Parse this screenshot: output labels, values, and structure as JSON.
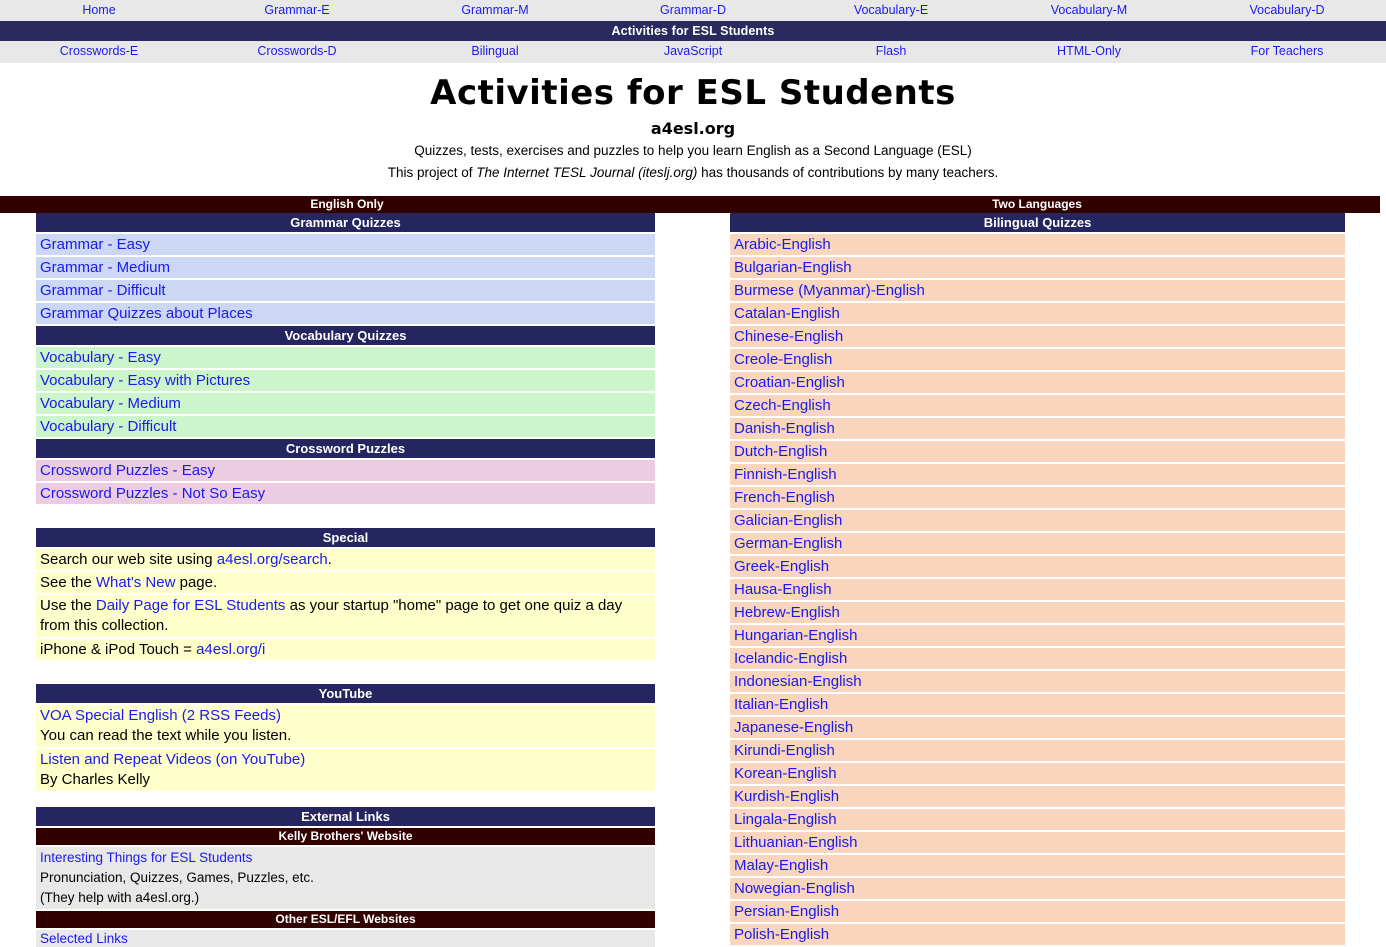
{
  "nav_top": [
    {
      "label": "Home"
    },
    {
      "label": "Grammar-E"
    },
    {
      "label": "Grammar-M"
    },
    {
      "label": "Grammar-D"
    },
    {
      "label": "Vocabulary-E"
    },
    {
      "label": "Vocabulary-M"
    },
    {
      "label": "Vocabulary-D"
    }
  ],
  "site_titlebar": "Activities for ESL Students",
  "nav_bottom": [
    {
      "label": "Crosswords-E"
    },
    {
      "label": "Crosswords-D"
    },
    {
      "label": "Bilingual"
    },
    {
      "label": "JavaScript"
    },
    {
      "label": "Flash"
    },
    {
      "label": "HTML-Only"
    },
    {
      "label": "For Teachers"
    }
  ],
  "masthead": {
    "title": "Activities for ESL Students",
    "sitename": "a4esl.org",
    "tagline1": "Quizzes, tests, exercises and puzzles to help you learn English as a Second Language (ESL)",
    "tagline2_pre": "This project of ",
    "tagline2_em": "The Internet TESL Journal (iteslj.org)",
    "tagline2_post": " has thousands of contributions by many teachers."
  },
  "left": {
    "banner": "English Only",
    "grammar": {
      "header": "Grammar Quizzes",
      "items": [
        "Grammar - Easy",
        "Grammar - Medium",
        "Grammar - Difficult",
        "Grammar Quizzes about Places"
      ]
    },
    "vocabulary": {
      "header": "Vocabulary Quizzes",
      "items": [
        "Vocabulary - Easy",
        "Vocabulary - Easy with Pictures",
        "Vocabulary - Medium",
        "Vocabulary - Difficult"
      ]
    },
    "crossword": {
      "header": "Crossword Puzzles",
      "items": [
        "Crossword Puzzles - Easy",
        "Crossword Puzzles - Not So Easy"
      ]
    },
    "special": {
      "header": "Special",
      "row1_pre": "Search our web site using ",
      "row1_link": "a4esl.org/search",
      "row1_post": ".",
      "row2_pre": "See the ",
      "row2_link": "What's New",
      "row2_post": " page.",
      "row3_pre": "Use the ",
      "row3_link": "Daily Page for ESL Students",
      "row3_post": " as your startup \"home\" page to get one quiz a day from this collection.",
      "row4_pre": "iPhone & iPod Touch = ",
      "row4_link": "a4esl.org/i"
    },
    "youtube": {
      "header": "YouTube",
      "row1_link": "VOA Special English (2 RSS Feeds)",
      "row1_text": "You can read the text while you listen.",
      "row2_link": "Listen and Repeat Videos (on YouTube)",
      "row2_text": "By Charles Kelly"
    },
    "external": {
      "header": "External Links",
      "sub1": "Kelly Brothers' Website",
      "sub1_link": "Interesting Things for ESL Students",
      "sub1_text1": "Pronunciation, Quizzes, Games, Puzzles, etc.",
      "sub1_text2": "(They help with a4esl.org.)",
      "sub2": "Other ESL/EFL Websites",
      "sub2_link": "Selected Links"
    }
  },
  "right": {
    "banner": "Two Languages",
    "bilingual": {
      "header": "Bilingual Quizzes",
      "items": [
        "Arabic-English",
        "Bulgarian-English",
        "Burmese (Myanmar)-English",
        "Catalan-English",
        "Chinese-English",
        "Creole-English",
        "Croatian-English",
        "Czech-English",
        "Danish-English",
        "Dutch-English",
        "Finnish-English",
        "French-English",
        "Galician-English",
        "German-English",
        "Greek-English",
        "Hausa-English",
        "Hebrew-English",
        "Hungarian-English",
        "Icelandic-English",
        "Indonesian-English",
        "Italian-English",
        "Japanese-English",
        "Kirundi-English",
        "Korean-English",
        "Kurdish-English",
        "Lingala-English",
        "Lithuanian-English",
        "Malay-English",
        "Nowegian-English",
        "Persian-English",
        "Polish-English"
      ]
    }
  },
  "colors": {
    "link": "#1a1aee",
    "navy": "#252560",
    "maroon": "#330000",
    "grammar_bg": "#ccd6f5",
    "vocabulary_bg": "#ccf5cc",
    "crossword_bg": "#eccce0",
    "special_bg": "#ffffcc",
    "bilingual_bg": "#f8d5bc",
    "nav_bg": "#e8e8e8"
  }
}
